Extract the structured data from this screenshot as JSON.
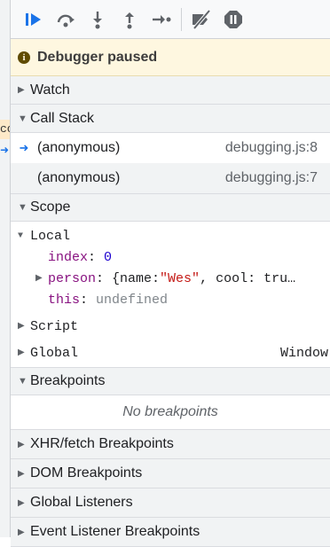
{
  "left_fragment": "co",
  "toolbar": {
    "buttons": [
      {
        "name": "resume-icon"
      },
      {
        "name": "step-over-icon"
      },
      {
        "name": "step-into-icon"
      },
      {
        "name": "step-out-icon"
      },
      {
        "name": "step-icon"
      },
      {
        "name": "deactivate-breakpoints-icon"
      },
      {
        "name": "pause-on-exceptions-icon"
      }
    ]
  },
  "status": {
    "text": "Debugger paused"
  },
  "sections": {
    "watch": "Watch",
    "call_stack": "Call Stack",
    "scope": "Scope",
    "breakpoints": "Breakpoints",
    "xhr": "XHR/fetch Breakpoints",
    "dom": "DOM Breakpoints",
    "global_listeners": "Global Listeners",
    "event_listener": "Event Listener Breakpoints"
  },
  "call_stack": [
    {
      "fn": "(anonymous)",
      "location": "debugging.js:8"
    },
    {
      "fn": "(anonymous)",
      "location": "debugging.js:7"
    }
  ],
  "scope": {
    "local": "Local",
    "index_key": "index",
    "index_val": "0",
    "person_key": "person",
    "person_open": "{name: ",
    "person_name": "\"Wes\"",
    "person_rest": ", cool: tru…",
    "this_key": "this",
    "this_val": "undefined",
    "script": "Script",
    "global": "Global",
    "global_val": "Window"
  },
  "breakpoints": {
    "empty": "No breakpoints"
  },
  "colors": {
    "accent": "#1a73e8",
    "paused_bg": "#fef7e0"
  }
}
